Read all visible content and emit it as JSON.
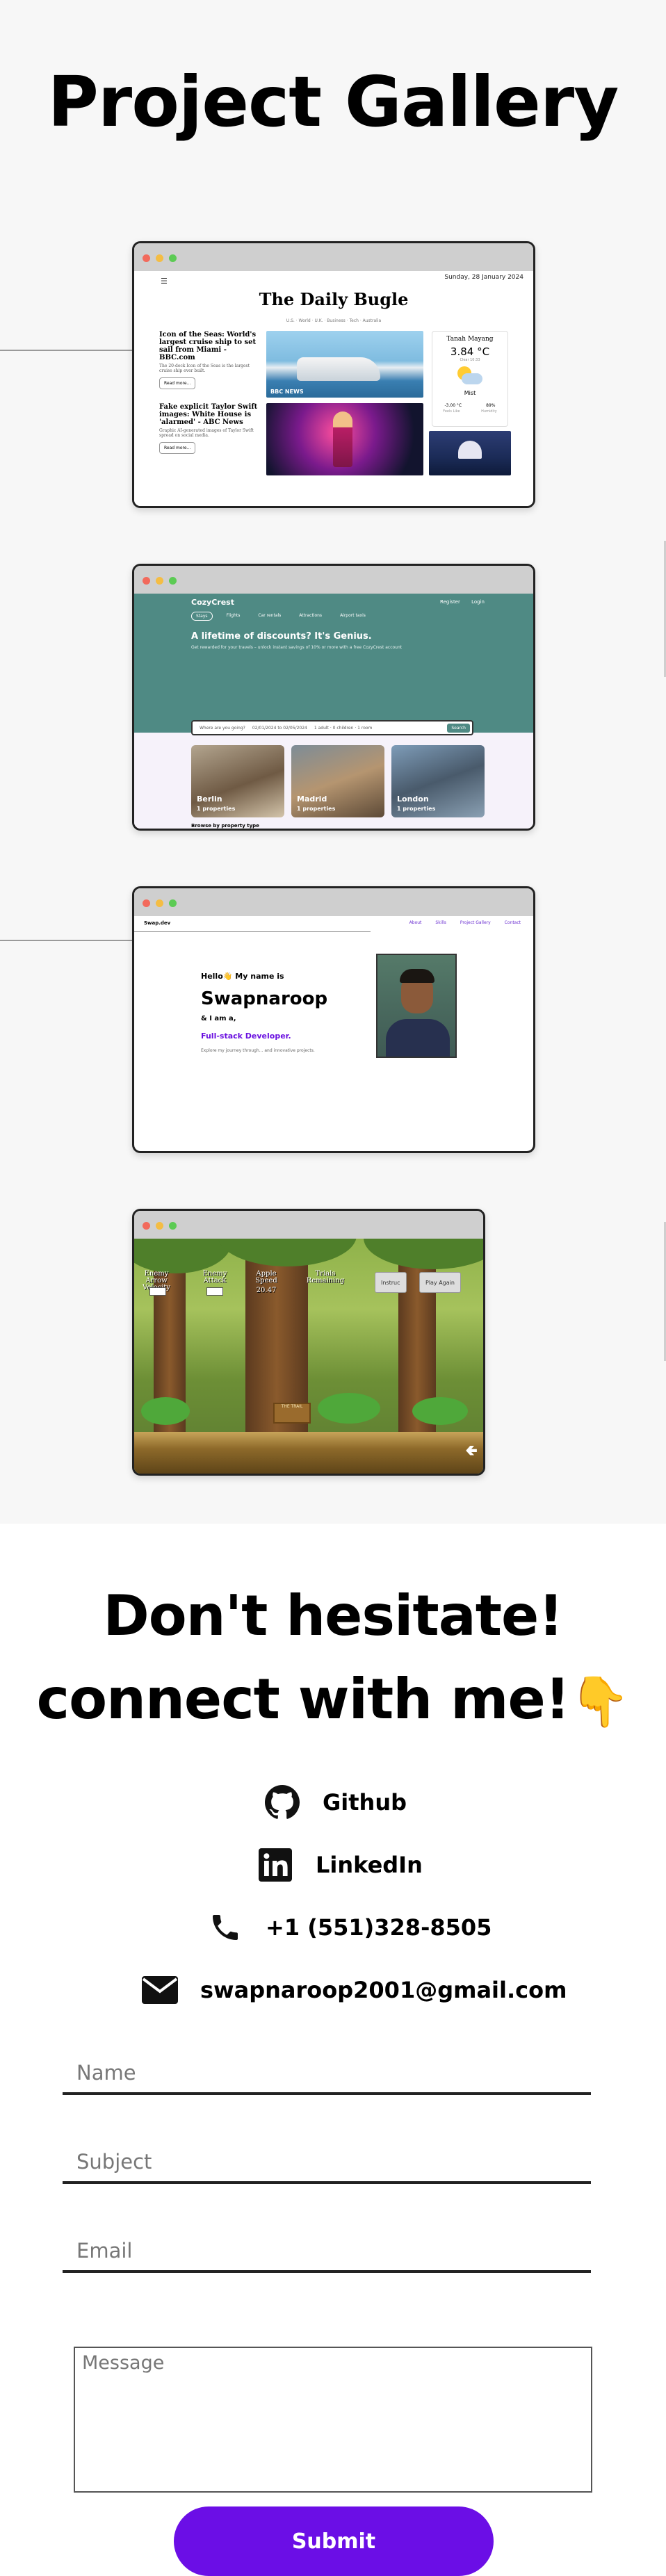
{
  "gallery": {
    "title": "Project Gallery",
    "projects": {
      "bugle": {
        "date": "Sunday, 28 January 2024",
        "menu_icon": "menu-icon",
        "title": "The Daily Bugle",
        "nav": "U.S. · World · U.K. · Business · Tech · Australia",
        "article1_title": "Icon of the Seas: World's largest cruise ship to set sail from Miami - BBC.com",
        "article1_sub": "The 20-deck Icon of the Seas is the largest cruise ship ever built.",
        "article1_btn": "Read more...",
        "article2_title": "Fake explicit Taylor Swift images: White House is 'alarmed' - ABC News",
        "article2_sub": "Graphic AI-generated images of Taylor Swift spread on social media.",
        "article2_btn": "Read more...",
        "image_label": "BBC NEWS",
        "weather_city": "Tanah Mayang",
        "weather_temp": "3.84 °C",
        "weather_time": "Clear 10:33",
        "weather_cond": "Mist",
        "weather_feels": "-3.00 °C",
        "weather_humidity": "89%",
        "weather_feels_lbl": "Feels Like",
        "weather_humidity_lbl": "Humidity"
      },
      "cozy": {
        "brand": "CozyCrest",
        "register": "Register",
        "login": "Login",
        "tabs": [
          "Stays",
          "Flights",
          "Car rentals",
          "Attractions",
          "Airport taxis"
        ],
        "headline": "A lifetime of discounts? It's Genius.",
        "subline": "Get rewarded for your travels – unlock instant savings of 10% or more with a free CozyCrest account",
        "search_dest": "Where are you going?",
        "search_dates": "02/01/2024 to 02/05/2024",
        "search_people": "1 adult · 0 children · 1 room",
        "search_btn": "Search",
        "cities": [
          {
            "name": "Berlin",
            "count": "1 properties"
          },
          {
            "name": "Madrid",
            "count": "1 properties"
          },
          {
            "name": "London",
            "count": "1 properties"
          }
        ],
        "browse": "Browse by property type"
      },
      "portfolio": {
        "brand": "Swap.dev",
        "links": [
          "About",
          "Skills",
          "Project Gallery",
          "Contact"
        ],
        "hello": "Hello👋 My name is",
        "name": "Swapnaroop",
        "iam": "& I am a,",
        "role": "Full-stack Developer.",
        "tagline": "Explore my journey through... and innovative projects."
      },
      "game": {
        "hud": [
          "Enemy Arrow Velocity",
          "Enemy Attack",
          "Apple Speed",
          "Trials Remaining"
        ],
        "speed": "20.47",
        "btn_instr": "Instruc",
        "btn_play": "Play Again",
        "sign": "THE TRAIL",
        "arrow_icon": "left-arrow-icon"
      }
    }
  },
  "contact": {
    "title_line1": "Don't hesitate!",
    "title_line2": "connect with me!",
    "emoji": "👇",
    "links": [
      {
        "icon": "github-icon",
        "label": "Github"
      },
      {
        "icon": "linkedin-icon",
        "label": "LinkedIn"
      },
      {
        "icon": "phone-icon",
        "label": "+1 (551)328-8505"
      },
      {
        "icon": "mail-icon",
        "label": "swapnaroop2001@gmail.com"
      }
    ]
  },
  "form": {
    "name_placeholder": "Name",
    "subject_placeholder": "Subject",
    "email_placeholder": "Email",
    "message_placeholder": "Message",
    "submit_label": "Submit"
  },
  "colors": {
    "accent": "#6b0ee6",
    "cozy_teal": "#4f8a84"
  }
}
